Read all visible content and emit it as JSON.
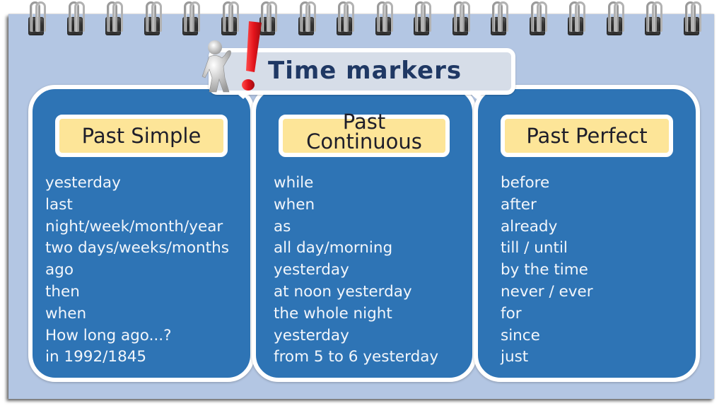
{
  "title": "Time markers",
  "colors": {
    "page_background": "#b3c6e3",
    "card_background": "#2e74b5",
    "card_header_background": "#fde598",
    "title_text": "#1f3864",
    "title_box_background": "#d6dde8",
    "exclamation_mark": "#e3131b"
  },
  "decor": {
    "binding_ring_count": 18,
    "figure_icon": "3d-person-waving",
    "exclamation_icon": "red-exclamation-mark"
  },
  "columns": [
    {
      "heading": "Past Simple",
      "items": [
        "yesterday",
        "last",
        "night/week/month/year",
        "two days/weeks/months",
        "ago",
        "then",
        "when",
        "How long ago...?",
        "in 1992/1845"
      ]
    },
    {
      "heading": "Past Continuous",
      "heading_lines": [
        "Past",
        "Continuous"
      ],
      "items": [
        "while",
        "when",
        "as",
        "all day/morning",
        "yesterday",
        "at noon yesterday",
        "the whole night",
        "yesterday",
        "from 5 to 6 yesterday"
      ]
    },
    {
      "heading": "Past Perfect",
      "items": [
        "before",
        "after",
        "already",
        "till / until",
        "by the time",
        "never / ever",
        "for",
        "since",
        "just"
      ]
    }
  ]
}
